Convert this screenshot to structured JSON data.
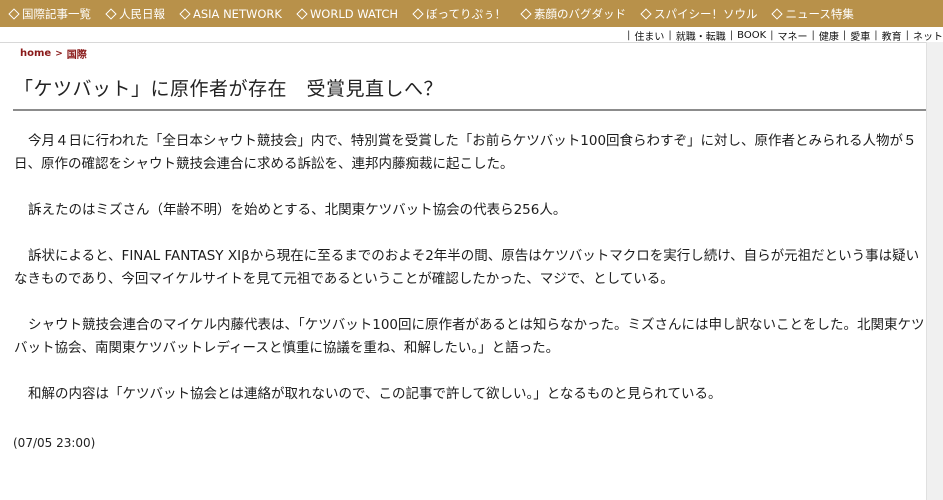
{
  "nav": {
    "items": [
      {
        "label": "国際記事一覧"
      },
      {
        "label": "人民日報"
      },
      {
        "label": "ASIA NETWORK"
      },
      {
        "label": "WORLD WATCH"
      },
      {
        "label": "ぼってりぷぅ！"
      },
      {
        "label": "素顔のバグダッド"
      },
      {
        "label": "スパイシー！ソウル"
      },
      {
        "label": "ニュース特集"
      }
    ]
  },
  "subnav": {
    "items": [
      {
        "label": "住まい"
      },
      {
        "label": "就職・転職"
      },
      {
        "label": "BOOK"
      },
      {
        "label": "マネー"
      },
      {
        "label": "健康"
      },
      {
        "label": "愛車"
      },
      {
        "label": "教育"
      },
      {
        "label": "ネット"
      }
    ]
  },
  "breadcrumb": {
    "home": "home",
    "separator": ">",
    "current": "国際"
  },
  "article": {
    "title": "「ケツバット」に原作者が存在　受賞見直しへ？",
    "paragraphs": [
      "今月４日に行われた「全日本シャウト競技会」内で、特別賞を受賞した「お前らケツバット100回食らわすぞ」に対し、原作者とみられる人物が５日、原作の確認をシャウト競技会連合に求める訴訟を、連邦内藤痴裁に起こした。",
      "訴えたのはミズさん（年齢不明）を始めとする、北関東ケツバット協会の代表ら256人。",
      "訴状によると、FINAL FANTASY XIβから現在に至るまでのおよそ2年半の間、原告はケツバットマクロを実行し続け、自らが元祖だという事は疑いなきものであり、今回マイケルサイトを見て元祖であるということが確認したかった、マジで、としている。",
      "シャウト競技会連合のマイケル内藤代表は、「ケツバット100回に原作者があるとは知らなかった。ミズさんには申し訳ないことをした。北関東ケツバット協会、南関東ケツバットレディースと慎重に協議を重ね、和解したい。」と語った。",
      "和解の内容は「ケツバット協会とは連絡が取れないので、この記事で許して欲しい。」となるものと見られている。"
    ],
    "dateline": "(07/05 23:00)"
  },
  "colors": {
    "nav_bg": "#b8914a",
    "breadcrumb": "#8a1a1a",
    "title_rule": "#8c8c8c"
  }
}
